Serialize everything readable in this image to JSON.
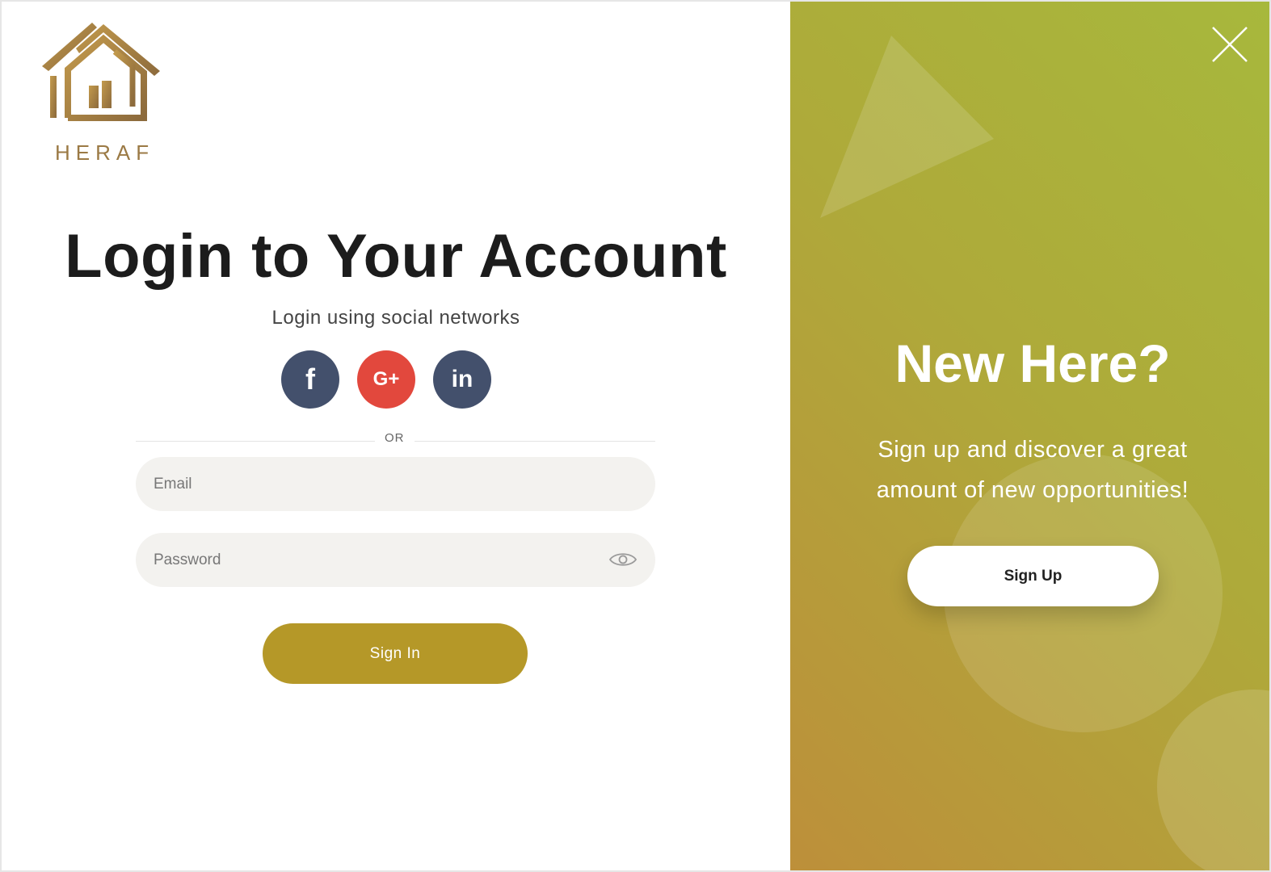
{
  "brand": {
    "name": "HERAF",
    "logo_color": "#9b7a45"
  },
  "login": {
    "title": "Login to Your Account",
    "subtitle": "Login using social networks",
    "socials": [
      {
        "label": "f",
        "network": "facebook",
        "color": "#43506c"
      },
      {
        "label": "G+",
        "network": "google-plus",
        "color": "#e2483d"
      },
      {
        "label": "in",
        "network": "linkedin",
        "color": "#43506c"
      }
    ],
    "divider_label": "OR",
    "email_placeholder": "Email",
    "password_placeholder": "Password",
    "signin_label": "Sign In",
    "accent_color": "#b59828"
  },
  "signup_panel": {
    "title": "New Here?",
    "text": "Sign up and discover a great amount of new opportunities!",
    "signup_label": "Sign Up"
  }
}
